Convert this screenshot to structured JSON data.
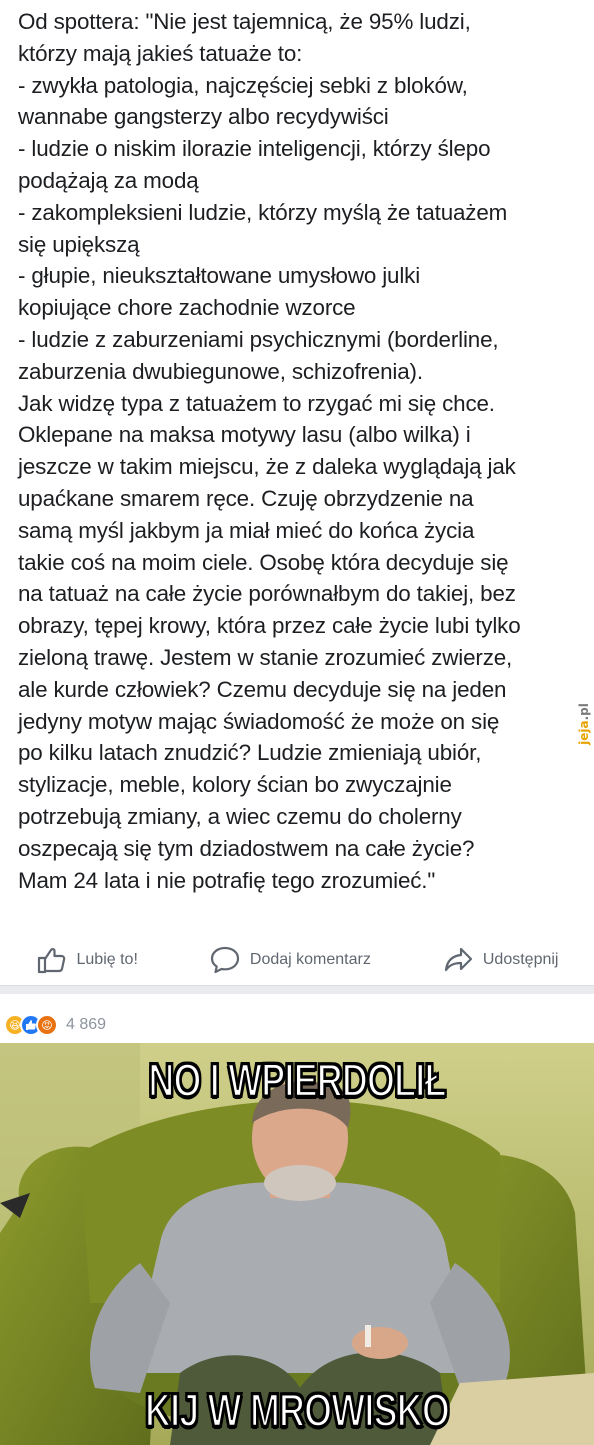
{
  "post": {
    "lines": [
      "Od spottera: \"Nie jest tajemnicą, że 95% ludzi,",
      "którzy mają jakieś tatuaże to:",
      "- zwykła patologia, najczęściej sebki z bloków,",
      "wannabe gangsterzy albo recydywiści",
      "- ludzie o niskim ilorazie inteligencji, którzy ślepo",
      "podążają za modą",
      "- zakompleksieni ludzie, którzy myślą że tatuażem",
      "się upiększą",
      "- głupie, nieukształtowane umysłowo julki",
      "kopiujące chore zachodnie wzorce",
      "- ludzie z zaburzeniami psychicznymi (borderline,",
      "zaburzenia dwubiegunowe, schizofrenia).",
      "Jak widzę typa z tatuażem to rzygać mi się chce.",
      "Oklepane na maksa motywy lasu (albo wilka) i",
      "jeszcze w takim miejscu, że z daleka wyglądają jak",
      "upaćkane smarem ręce. Czuję obrzydzenie na",
      "samą myśl jakbym ja miał mieć do końca życia",
      "takie coś na moim ciele. Osobę która decyduje się",
      "na tatuaż na całe życie porównałbym do takiej, bez",
      "obrazy, tępej krowy, która przez całe życie lubi tylko",
      "zieloną trawę. Jestem w stanie zrozumieć zwierze,",
      "ale kurde człowiek? Czemu decyduje się na jeden",
      "jedyny motyw mając świadomość że może on się",
      "po kilku latach znudzić? Ludzie zmieniają ubiór,",
      "stylizacje, meble, kolory ścian bo zwyczajnie",
      "potrzebują zmiany, a wiec czemu do cholerny",
      "oszpecają się tym dziadostwem na całe życie?",
      "Mam 24 lata i nie potrafię tego zrozumieć.\""
    ]
  },
  "watermark": {
    "text_a": "jeja",
    "text_b": ".pl"
  },
  "actions": {
    "like": {
      "label": "Lubię to!",
      "icon": "thumbs-up-icon"
    },
    "comment": {
      "label": "Dodaj komentarz",
      "icon": "comment-bubble-icon"
    },
    "share": {
      "label": "Udostępnij",
      "icon": "share-arrow-icon"
    }
  },
  "reactions": {
    "types": [
      "haha",
      "like",
      "angry"
    ],
    "count": "4 869"
  },
  "meme": {
    "top_caption": "NO I WPIERDOLIŁ",
    "bottom_caption": "KIJ W MROWISKO"
  }
}
